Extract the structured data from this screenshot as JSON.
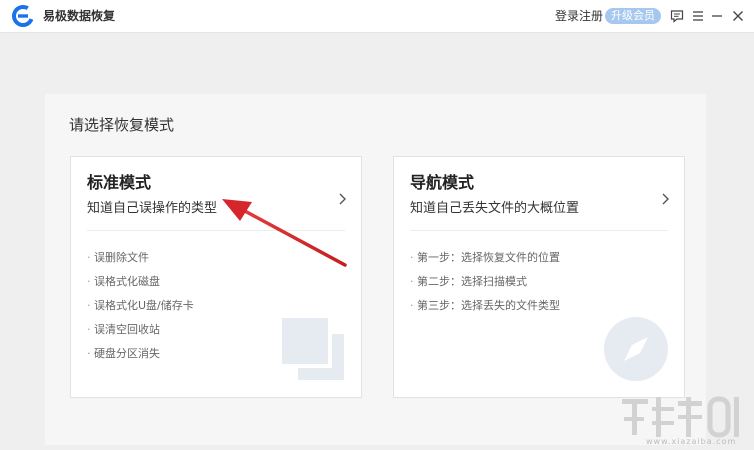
{
  "app": {
    "title": "易极数据恢复",
    "login_label": "登录注册",
    "vip_label": "升级会员"
  },
  "panel": {
    "title": "请选择恢复模式"
  },
  "cards": [
    {
      "title": "标准模式",
      "subtitle": "知道自己误操作的类型",
      "items": [
        "误删除文件",
        "误格式化磁盘",
        "误格式化U盘/储存卡",
        "误清空回收站",
        "硬盘分区消失"
      ]
    },
    {
      "title": "导航模式",
      "subtitle": "知道自己丢失文件的大概位置",
      "items": [
        "第一步：选择恢复文件的位置",
        "第二步：选择扫描模式",
        "第三步：选择丢失的文件类型"
      ]
    }
  ],
  "watermark": {
    "url": "www.xiazaiba.com"
  },
  "colors": {
    "accent": "#1a73e8",
    "vip_badge": "#a7c8ee",
    "annotation_arrow": "#d6262b"
  },
  "icons": {
    "logo": "app-logo-icon",
    "feedback": "feedback-icon",
    "menu": "menu-icon",
    "minimize": "minimize-icon",
    "close": "close-icon",
    "card_arrow": "chevron-right-icon"
  }
}
